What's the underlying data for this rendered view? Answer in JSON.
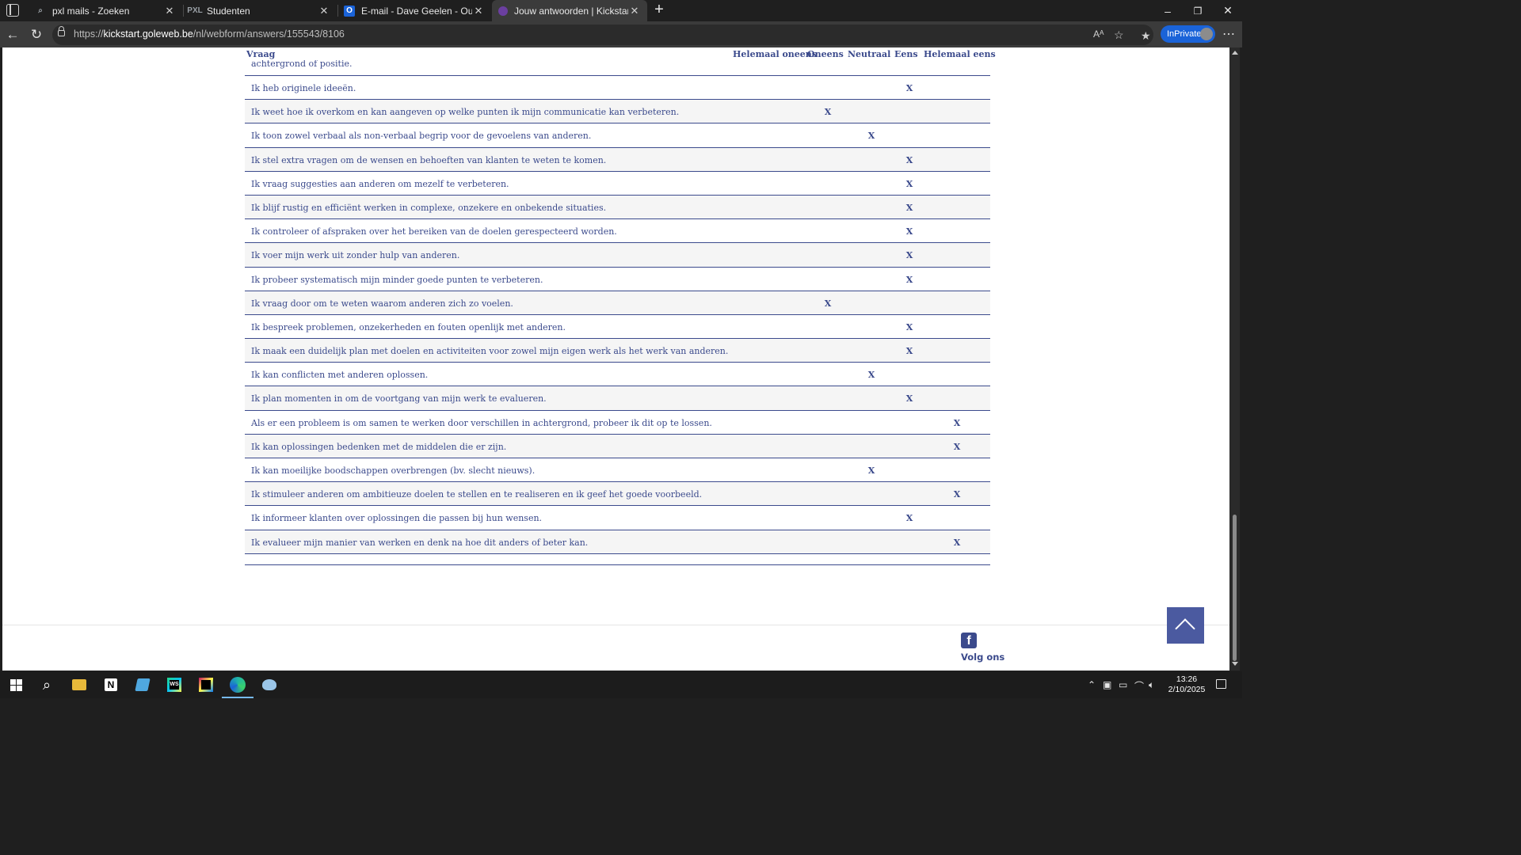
{
  "browser": {
    "tabs": [
      {
        "title": "pxl mails - Zoeken",
        "favicon": "search-icon"
      },
      {
        "title": "Studenten",
        "favicon": "pxl-icon"
      },
      {
        "title": "E-mail - Dave Geelen - Outlook",
        "favicon": "outlook-icon"
      },
      {
        "title": "Jouw antwoorden | Kickstart - Ler",
        "favicon": "kickstart-icon"
      }
    ],
    "url_prefix": "https://",
    "url_host": "kickstart.goleweb.be",
    "url_path": "/nl/webform/answers/155543/8106",
    "inprivate_label": "InPrivate"
  },
  "table": {
    "headers": {
      "question": "Vraag",
      "col1": "Helemaal oneens",
      "col2": "Oneens",
      "col3": "Neutraal",
      "col4": "Eens",
      "col5": "Helemaal eens"
    },
    "partial_row_text": "achtergrond of positie.",
    "mark": "X",
    "rows": [
      {
        "question": "Ik heb originele ideeën.",
        "answer": 4
      },
      {
        "question": "Ik weet hoe ik overkom en kan aangeven op welke punten ik mijn communicatie kan verbeteren.",
        "answer": 2
      },
      {
        "question": "Ik toon zowel verbaal als non-verbaal begrip voor de gevoelens van anderen.",
        "answer": 3
      },
      {
        "question": "Ik stel extra vragen om de wensen en behoeften van klanten te weten te komen.",
        "answer": 4
      },
      {
        "question": "Ik vraag suggesties aan anderen om mezelf te verbeteren.",
        "answer": 4
      },
      {
        "question": "Ik blijf rustig en efficiënt werken in complexe, onzekere en onbekende situaties.",
        "answer": 4
      },
      {
        "question": "Ik controleer of afspraken over het bereiken van de doelen gerespecteerd worden.",
        "answer": 4
      },
      {
        "question": "Ik voer mijn werk uit zonder hulp van anderen.",
        "answer": 4
      },
      {
        "question": "Ik probeer systematisch mijn minder goede punten te verbeteren.",
        "answer": 4
      },
      {
        "question": "Ik vraag door om te weten waarom anderen zich zo voelen.",
        "answer": 2
      },
      {
        "question": "Ik bespreek problemen, onzekerheden en fouten openlijk met anderen.",
        "answer": 4
      },
      {
        "question": "Ik maak een duidelijk plan met doelen en activiteiten voor zowel mijn eigen werk als het werk van anderen.",
        "answer": 4
      },
      {
        "question": "Ik kan conflicten met anderen oplossen.",
        "answer": 3
      },
      {
        "question": "Ik plan momenten in om de voortgang van mijn werk te evalueren.",
        "answer": 4
      },
      {
        "question": "Als er een probleem is om samen te werken door verschillen in achtergrond, probeer ik dit op te lossen.",
        "answer": 5
      },
      {
        "question": "Ik kan oplossingen bedenken met de middelen die er zijn.",
        "answer": 5
      },
      {
        "question": "Ik kan moeilijke boodschappen overbrengen (bv. slecht nieuws).",
        "answer": 3
      },
      {
        "question": "Ik stimuleer anderen om ambitieuze doelen te stellen en te realiseren en ik geef het goede voorbeeld.",
        "answer": 5
      },
      {
        "question": "Ik informeer klanten over oplossingen die passen bij hun wensen.",
        "answer": 4
      },
      {
        "question": "Ik evalueer mijn manier van werken en denk na hoe dit anders of beter kan.",
        "answer": 5
      }
    ]
  },
  "footer": {
    "follow_label": "Volg ons",
    "facebook_glyph": "f"
  },
  "taskbar": {
    "time": "13:26",
    "date": "2/10/2025"
  },
  "colors": {
    "accent": "#3b4a8c",
    "edge_blue": "#1a63d8"
  }
}
